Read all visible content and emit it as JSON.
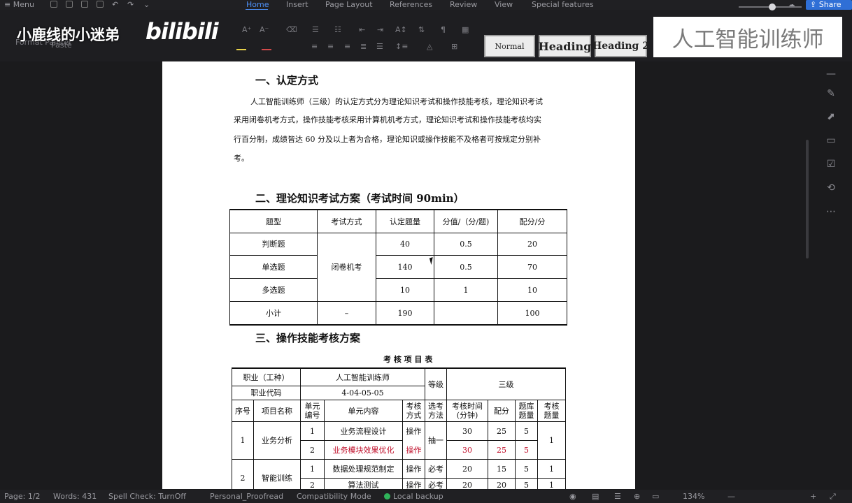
{
  "menubar": {
    "menu": "Menu",
    "tabs": [
      "Home",
      "Insert",
      "Page Layout",
      "References",
      "Review",
      "View",
      "Special features"
    ],
    "share": "Share"
  },
  "ribbon": {
    "format_painter": "Format Painter",
    "paste": "Paste",
    "styles": {
      "normal": "Normal",
      "heading1": "Heading",
      "heading2": "Heading 2"
    }
  },
  "overlay": {
    "left_watermark": "小鹿线的小迷弟",
    "bilibili": "bilibili",
    "right_banner": "人工智能训练师"
  },
  "doc": {
    "s1_title": "一、认定方式",
    "s1_lines": [
      "人工智能训练师（三级）的认定方式分为理论知识考试和操作技能考核，理论知识考试",
      "采用闭卷机考方式，操作技能考核采用计算机机考方式，理论知识考试和操作技能考核均实",
      "行百分制，成绩皆达 60 分及以上者为合格，理论知识或操作技能不及格者可按规定分别补",
      "考。"
    ],
    "s2_title": "二、理论知识考试方案（考试时间 90min）",
    "t1": {
      "headers": [
        "题型",
        "考试方式",
        "认定题量",
        "分值/（分/题)",
        "配分/分"
      ],
      "rows": [
        {
          "type": "判断题",
          "count": "40",
          "value": "0.5",
          "score": "20"
        },
        {
          "type": "单选题",
          "count": "140",
          "value": "0.5",
          "score": "70"
        },
        {
          "type": "多选题",
          "count": "10",
          "value": "1",
          "score": "10"
        },
        {
          "type": "小计",
          "count": "190",
          "value": "",
          "score": "100"
        }
      ],
      "method": "闭卷机考",
      "total_method": "–"
    },
    "s3_title": "三、操作技能考核方案",
    "t2": {
      "caption": "考 核 项 目 表",
      "occ_label": "职业（工种）",
      "occ_value": "人工智能训练师",
      "code_label": "职业代码",
      "code_value": "4-04-05-05",
      "level_label": "等级",
      "level_value": "三级",
      "headers": [
        "序号",
        "项目名称",
        "单元编号",
        "单元内容",
        "考核方式",
        "选考方法",
        "考核时间(分钟)",
        "配分",
        "题库题量",
        "考核题量"
      ],
      "g1": {
        "no": "1",
        "name": "业务分析",
        "select": "抽一",
        "exam_qty": "1",
        "units": [
          {
            "code": "1",
            "content": "业务流程设计",
            "mode": "操作",
            "time": "30",
            "score": "25",
            "bank": "5"
          },
          {
            "code": "2",
            "content": "业务模块效果优化",
            "mode": "操作",
            "time": "30",
            "score": "25",
            "bank": "5"
          }
        ]
      },
      "g2": {
        "no": "2",
        "name": "智能训练",
        "units": [
          {
            "code": "1",
            "content": "数据处理规范制定",
            "mode": "操作",
            "select": "必考",
            "time": "20",
            "score": "15",
            "bank": "5",
            "qty": "1"
          },
          {
            "code": "2",
            "content": "算法测试",
            "mode": "操作",
            "select": "必考",
            "time": "20",
            "score": "20",
            "bank": "5",
            "qty": "1"
          }
        ]
      }
    }
  },
  "status": {
    "page": "Page: 1/2",
    "words": "Words: 431",
    "spell": "Spell Check: TurnOff",
    "proof": "Personal_Proofread",
    "compat": "Compatibility Mode",
    "backup": "Local backup",
    "zoom": "134%"
  },
  "colors": {
    "accent": "#4d8ff5",
    "highlight_red": "#c0102b"
  }
}
